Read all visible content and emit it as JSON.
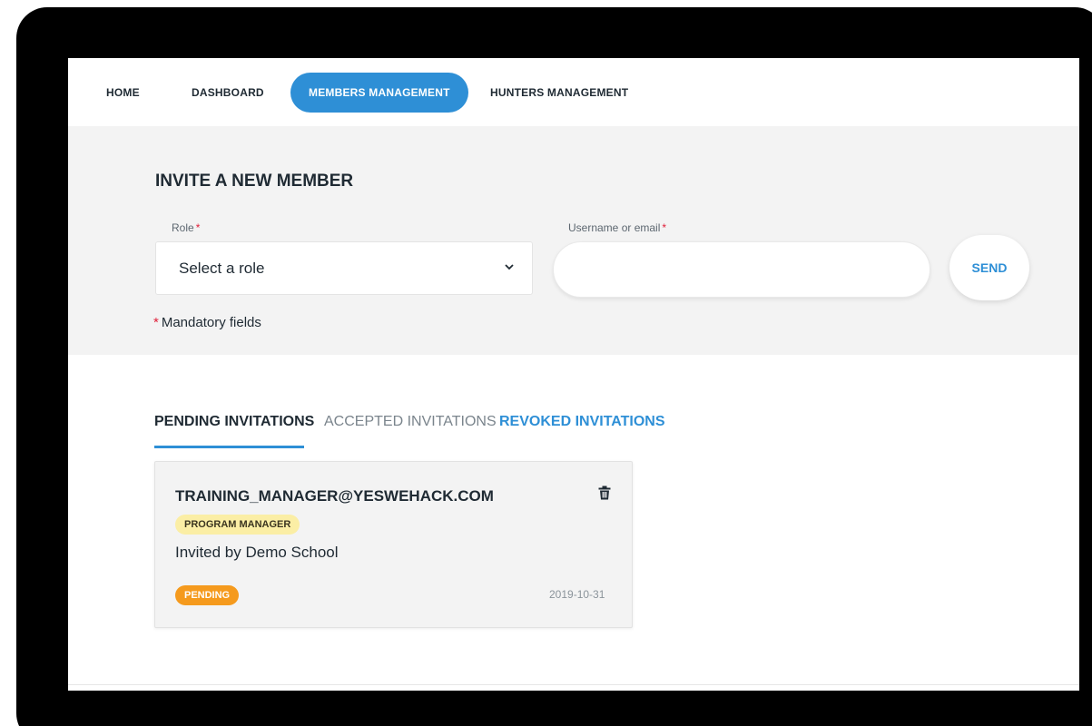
{
  "nav": {
    "items": [
      {
        "label": "HOME"
      },
      {
        "label": "DASHBOARD"
      },
      {
        "label": "MEMBERS MANAGEMENT"
      },
      {
        "label": "HUNTERS MANAGEMENT"
      }
    ],
    "active": "MEMBERS MANAGEMENT"
  },
  "invite": {
    "title": "INVITE A NEW MEMBER",
    "role_label": "Role",
    "role_value": "Select a role",
    "username_label": "Username or email",
    "required_mark": "*",
    "username_value": "",
    "send_label": "SEND",
    "mandatory_note": "Mandatory fields"
  },
  "tabs": [
    {
      "label": "PENDING INVITATIONS"
    },
    {
      "label": "ACCEPTED INVITATIONS"
    },
    {
      "label": "REVOKED INVITATIONS"
    }
  ],
  "active_tab": "PENDING INVITATIONS",
  "invitations": [
    {
      "email": "TRAINING_MANAGER@YESWEHACK.COM",
      "role": "PROGRAM MANAGER",
      "invited_by": "Invited by Demo School",
      "status": "PENDING",
      "date": "2019-10-31"
    }
  ],
  "icons": {
    "chevron": "chevron-down-icon",
    "delete": "trash-icon"
  },
  "colors": {
    "accent": "#2e8fd6",
    "required": "#e0203a",
    "role_badge": "#fbeea5",
    "status_pending": "#f59a1d"
  }
}
